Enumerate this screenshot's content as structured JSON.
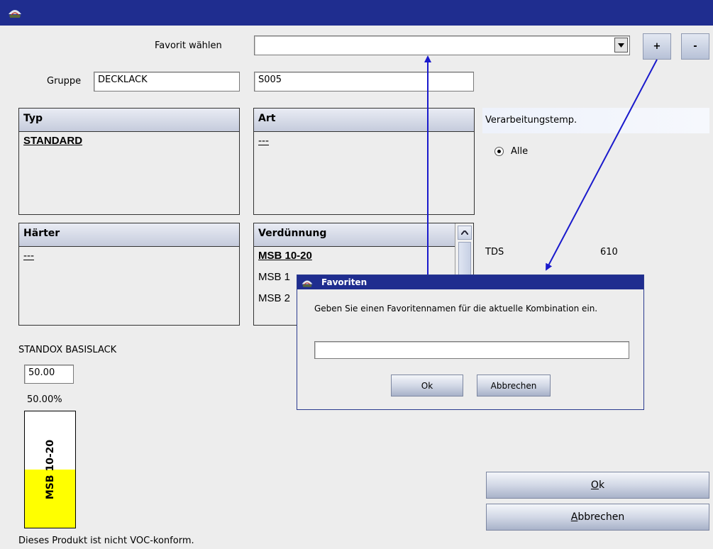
{
  "window": {
    "title": ""
  },
  "favorite": {
    "label": "Favorit wählen",
    "value": "",
    "add_label": "+",
    "remove_label": "-"
  },
  "group": {
    "label": "Gruppe",
    "value": "DECKLACK",
    "code": "S005"
  },
  "typ": {
    "header": "Typ",
    "items": [
      "STANDARD"
    ]
  },
  "art": {
    "header": "Art",
    "items": [
      "---"
    ]
  },
  "haerter": {
    "header": "Härter",
    "items": [
      "---"
    ]
  },
  "verduennung": {
    "header": "Verdünnung",
    "items": [
      "MSB 10-20",
      "MSB 1",
      "MSB 2"
    ]
  },
  "verarbeitung": {
    "header": "Verarbeitungstemp.",
    "option": "Alle"
  },
  "tds": {
    "label": "TDS",
    "value": "610"
  },
  "product": {
    "name": "STANDOX BASISLACK",
    "amount": "50.00",
    "percent_label": "50.00%",
    "bar_label": "MSB 10-20",
    "fill_fraction": 0.5,
    "fill_color": "#ffff00"
  },
  "buttons": {
    "ok": "Ok",
    "ok_mnemonic": "O",
    "ok_rest": "k",
    "cancel": "Abbrechen",
    "cancel_mnemonic": "A",
    "cancel_rest": "bbrechen"
  },
  "voc_note": "Dieses Produkt ist nicht VOC-konform.",
  "dialog": {
    "title": "Favoriten",
    "message": "Geben Sie einen Favoritennamen für die aktuelle Kombination ein.",
    "input_value": "",
    "ok_label": "Ok",
    "cancel_label": "Abbrechen"
  },
  "colors": {
    "titlebar": "#1f2d8f",
    "arrow": "#1a1acc",
    "accent_fill": "#ffff00"
  }
}
